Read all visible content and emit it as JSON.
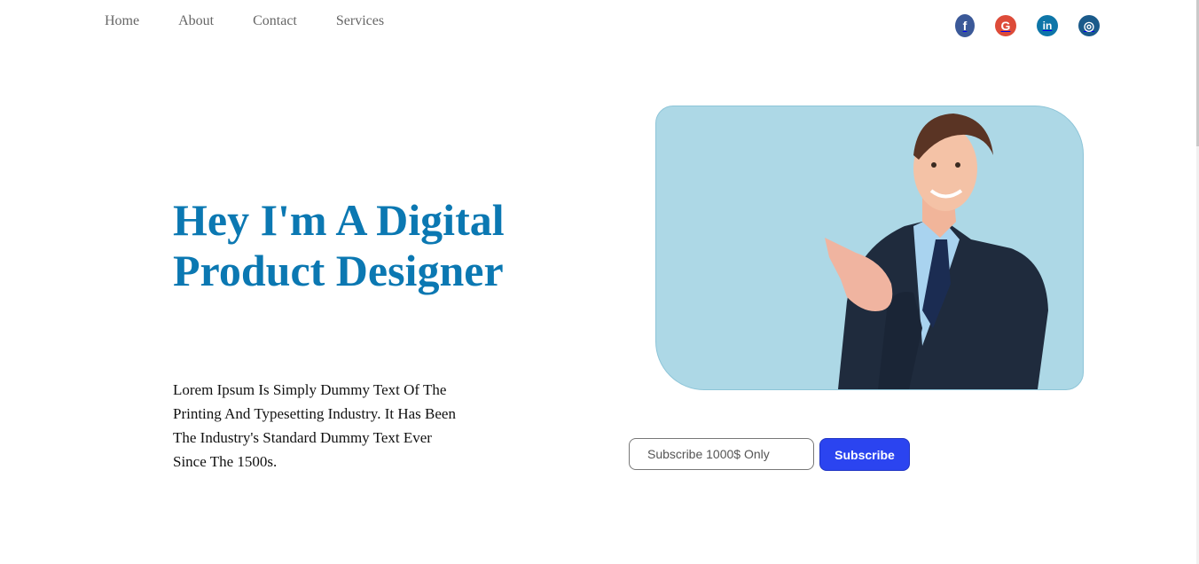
{
  "nav": {
    "items": [
      {
        "label": "Home"
      },
      {
        "label": "About"
      },
      {
        "label": "Contact"
      },
      {
        "label": "Services"
      }
    ]
  },
  "social": {
    "items": [
      {
        "name": "facebook-icon",
        "glyph": "f",
        "color": "#3b5998"
      },
      {
        "name": "google-icon",
        "glyph": "G",
        "color": "#dd4b39"
      },
      {
        "name": "linkedin-icon",
        "glyph": "in",
        "color": "#0e76a8"
      },
      {
        "name": "instagram-icon",
        "glyph": "◎",
        "color": "#1a5a8a"
      }
    ]
  },
  "hero": {
    "title": "Hey I'm A Digital Product Designer",
    "text": "Lorem Ipsum Is Simply Dummy Text Of The Printing And Typesetting Industry. It Has Been The Industry's Standard Dummy Text Ever Since The 1500s."
  },
  "subscribe": {
    "placeholder": "Subscribe 1000$ Only",
    "button_label": "Subscribe"
  },
  "colors": {
    "title": "#0b78b2",
    "image_bg": "#add8e6",
    "button": "#2b44f0"
  }
}
